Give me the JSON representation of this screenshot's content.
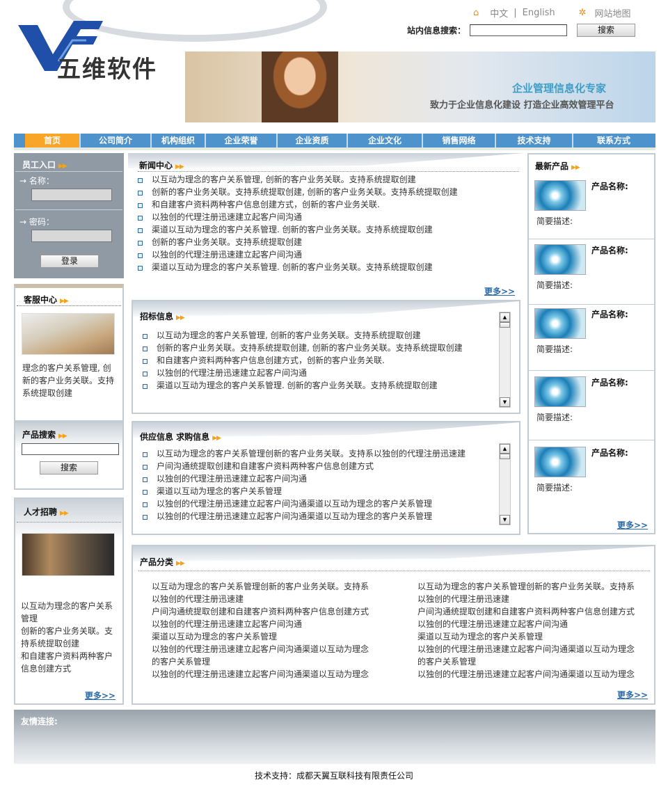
{
  "header": {
    "logo_text": "五维软件",
    "lang_cn": "中文",
    "lang_sep": "|",
    "lang_en": "English",
    "sitemap": "网站地图",
    "search_label": "站内信息搜索：",
    "search_button": "搜索"
  },
  "banner": {
    "line1": "企业管理信息化专家",
    "line2": "致力于企业信息化建设  打造企业高效管理平台"
  },
  "nav": [
    "首页",
    "公司简介",
    "机构组织",
    "企业荣誉",
    "企业资质",
    "企业文化",
    "销售网络",
    "技术支持",
    "联系方式"
  ],
  "login": {
    "title": "员工入口",
    "name_label": "名称：",
    "password_label": "密码：",
    "button": "登录"
  },
  "service": {
    "title": "客服中心",
    "text": "理念的客户关系管理, 创新的客户业务关联。支持系统提取创建"
  },
  "product_search": {
    "title": "产品搜索",
    "button": "搜索"
  },
  "jobs": {
    "title": "人才招聘",
    "text1": "以互动为理念的客户关系管理",
    "text2": "创新的客户业务关联。支持系统提取创建",
    "text3": "和自建客户资料两种客户信息创建方式",
    "more": "更多>>"
  },
  "news": {
    "title": "新闻中心",
    "items": [
      "以互动为理念的客户关系管理, 创新的客户业务关联。支持系统提取创建",
      "创新的客户业务关联。支持系统提取创建, 创新的客户业务关联。支持系统提取创建",
      "和自建客户资料两种客户信息创建方式，创新的客户业务关联.",
      "以独创的代理注册迅速建立起客户间沟通",
      "渠道以互动为理念的客户关系管理. 创新的客户业务关联。支持系统提取创建",
      "创新的客户业务关联。支持系统提取创建",
      "以独创的代理注册迅速建立起客户间沟通",
      "渠道以互动为理念的客户关系管理. 创新的客户业务关联。支持系统提取创建"
    ],
    "more": "更多>>"
  },
  "tender": {
    "title": "招标信息",
    "items": [
      "以互动为理念的客户关系管理, 创新的客户业务关联。支持系统提取创建",
      "创新的客户业务关联。支持系统提取创建, 创新的客户业务关联。支持系统提取创建",
      "和自建客户资料两种客户信息创建方式，创新的客户业务关联.",
      "以独创的代理注册迅速建立起客户间沟通",
      "渠道以互动为理念的客户关系管理. 创新的客户业务关联。支持系统提取创建"
    ]
  },
  "supply": {
    "title": "供应信息  求购信息",
    "items": [
      "以互动为理念的客户关系管理创新的客户业务关联。支持系以独创的代理注册迅速建",
      "户间沟通统提取创建和自建客户资料两种客户信息创建方式",
      "以独创的代理注册迅速建立起客户间沟通",
      "渠道以互动为理念的客户关系管理",
      "以独创的代理注册迅速建立起客户间沟通渠道以互动为理念的客户关系管理",
      "以独创的代理注册迅速建立起客户间沟通渠道以互动为理念的客户关系管理"
    ]
  },
  "latest": {
    "title": "最新产品",
    "name_label": "产品名称:",
    "desc_label": "简要描述:",
    "more": "更多>>"
  },
  "category": {
    "title": "产品分类",
    "lines": [
      "以互动为理念的客户关系管理创新的客户业务关联。支持系",
      "以独创的代理注册迅速建",
      "户间沟通统提取创建和自建客户资料两种客户信息创建方式",
      "以独创的代理注册迅速建立起客户间沟通",
      "渠道以互动为理念的客户关系管理",
      "以独创的代理注册迅速建立起客户间沟通渠道以互动为理念",
      "的客户关系管理",
      "以独创的代理注册迅速建立起客户间沟通渠道以互动为理念"
    ],
    "more": "更多>>"
  },
  "links": {
    "title": "友情连接:"
  },
  "footer": {
    "text": "技术支持：成都天翼互联科技有限责任公司"
  }
}
